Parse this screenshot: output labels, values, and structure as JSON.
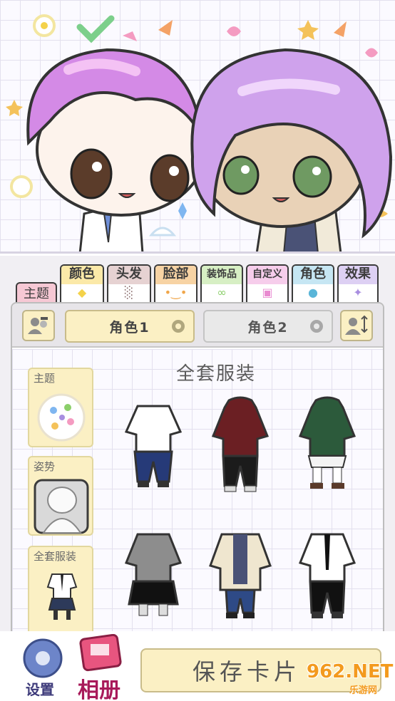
{
  "tabs": {
    "theme": "主题",
    "items": [
      {
        "label": "颜色",
        "icon": "drop-icon",
        "color": "#f4d24a",
        "bg": "#fbe9a8"
      },
      {
        "label": "头发",
        "icon": "comb-icon",
        "color": "#8a6d6d",
        "bg": "#e6d2d2"
      },
      {
        "label": "脸部",
        "icon": "face-icon",
        "color": "#f0a64a",
        "bg": "#f7d3a4"
      },
      {
        "label": "装饰品",
        "icon": "glasses-icon",
        "color": "#8bcf6a",
        "bg": "#d7efc4"
      },
      {
        "label": "自定义",
        "icon": "image-icon",
        "color": "#e98ad0",
        "bg": "#f6cdeb"
      },
      {
        "label": "角色",
        "icon": "person-icon",
        "color": "#5ab5d8",
        "bg": "#c6e6f3"
      },
      {
        "label": "效果",
        "icon": "sparkle-icon",
        "color": "#a88ee0",
        "bg": "#ddd0f3"
      }
    ]
  },
  "characters": {
    "char1": "角色1",
    "char2": "角色2"
  },
  "sidebar": {
    "items": [
      {
        "label": "主题"
      },
      {
        "label": "姿势"
      },
      {
        "label": "全套服装"
      }
    ]
  },
  "main": {
    "section_title": "全套服装"
  },
  "bottom": {
    "settings": "设置",
    "album": "相册",
    "save": "保存卡片"
  },
  "watermark": {
    "brand": "962.NET",
    "sub": "乐游网"
  }
}
